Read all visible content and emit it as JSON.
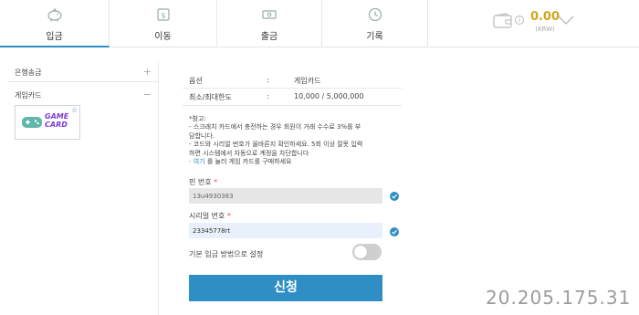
{
  "nav": {
    "tabs": [
      {
        "label": "입금",
        "icon": "piggy-bank-icon",
        "active": true
      },
      {
        "label": "이동",
        "icon": "money-transfer-icon",
        "active": false
      },
      {
        "label": "출금",
        "icon": "cash-withdraw-icon",
        "active": false
      },
      {
        "label": "기록",
        "icon": "history-clock-icon",
        "active": false
      }
    ]
  },
  "balance": {
    "amount": "0.00",
    "currency": "(KRW)",
    "info_symbol": "i"
  },
  "sidebar": {
    "items": [
      {
        "label": "은행송금",
        "sign": "+"
      },
      {
        "label": "게임카드",
        "sign": "−"
      }
    ],
    "card": {
      "line1": "GAME",
      "line2": "CARD",
      "star": "☆"
    }
  },
  "form": {
    "option_key": "옵션",
    "option_colon": ":",
    "option_value": "게임카드",
    "limit_key": "최소/최대한도",
    "limit_colon": ":",
    "limit_value": "10,000 / 5,000,000",
    "note": {
      "title": "*참고:",
      "line1": "- 스크래치 카드에서 충전하는 경우 회원이 거래 수수료 3%를 부",
      "line2": "담합니다.",
      "line3": "- 코드와 시리얼 번호가 올바른지 확인하세요. 5회 이상 잘못 입력",
      "line4": "하면 시스템에서 자동으로 계정을 차단합니다",
      "line5_link": "- 여기",
      "line5_rest": " 를 눌러 게임 카드를 구매하세요"
    },
    "pin_label": "핀 번호",
    "pin_required": "*",
    "pin_value": "13u4930383",
    "serial_label": "시리얼 번호",
    "serial_required": "*",
    "serial_value": "23345778rt",
    "default_label": "기본 입금 방법으로 설정",
    "default_on": false,
    "submit_label": "신청"
  },
  "watermark": "20.205.175.31",
  "colors": {
    "accent": "#2f8fc4",
    "gold": "#d4a520",
    "card_purple": "#7b3bd6"
  }
}
